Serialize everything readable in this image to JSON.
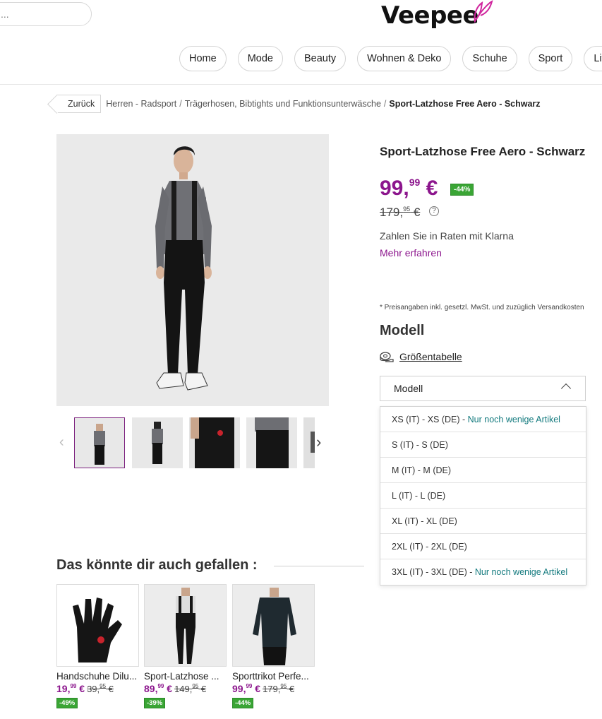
{
  "header": {
    "search_text": "...",
    "logo_text": "Veepee",
    "nav": [
      "Home",
      "Mode",
      "Beauty",
      "Wohnen & Deko",
      "Schuhe",
      "Sport",
      "Life"
    ]
  },
  "breadcrumb": {
    "back_label": "Zurück",
    "items": [
      "Herren - Radsport",
      "Trägerhosen, Bibtights und Funktionsunterwäsche"
    ],
    "current": "Sport-Latzhose Free Aero - Schwarz",
    "separator": "/"
  },
  "product": {
    "title": "Sport-Latzhose Free Aero - Schwarz",
    "price_main": "99,",
    "price_cents": "99",
    "price_currency": "€",
    "discount": "-44%",
    "old_price_main": "179,",
    "old_price_cents": "95",
    "old_price_currency": "€",
    "help_icon": "?",
    "klarna_text": "Zahlen Sie in Raten mit Klarna",
    "more_link": "Mehr erfahren",
    "tax_note": "* Preisangaben inkl. gesetzl. MwSt. und zuzüglich Versandkosten",
    "model_heading": "Modell",
    "size_chart_label": "Größentabelle",
    "select_value": "Modell"
  },
  "sizes": [
    {
      "label": "XS (IT) - XS (DE)",
      "sep": " - ",
      "note": "Nur noch wenige Artikel"
    },
    {
      "label": "S (IT) - S (DE)",
      "sep": "",
      "note": ""
    },
    {
      "label": "M (IT) - M (DE)",
      "sep": "",
      "note": ""
    },
    {
      "label": "L (IT) - L (DE)",
      "sep": "",
      "note": ""
    },
    {
      "label": "XL (IT) - XL (DE)",
      "sep": "",
      "note": ""
    },
    {
      "label": "2XL (IT) - 2XL (DE)",
      "sep": "",
      "note": ""
    },
    {
      "label": "3XL (IT) - 3XL (DE)",
      "sep": " - ",
      "note": "Nur noch wenige Artikel"
    }
  ],
  "recommendations": {
    "title": "Das könnte dir auch gefallen :",
    "items": [
      {
        "name": "Handschuhe Dilu...",
        "price_main": "19,",
        "price_cents": "99",
        "price_currency": " €",
        "old_main": "39,",
        "old_cents": "95",
        "old_currency": " €",
        "badge": "-49%"
      },
      {
        "name": "Sport-Latzhose ...",
        "price_main": "89,",
        "price_cents": "99",
        "price_currency": " €",
        "old_main": "149,",
        "old_cents": "95",
        "old_currency": " €",
        "badge": "-39%"
      },
      {
        "name": "Sporttrikot Perfe...",
        "price_main": "99,",
        "price_cents": "99",
        "price_currency": " €",
        "old_main": "179,",
        "old_cents": "95",
        "old_currency": " €",
        "badge": "-44%"
      }
    ]
  },
  "colors": {
    "brand_purple": "#8c168d",
    "discount_green": "#3aa535",
    "stock_note_teal": "#137a7e"
  }
}
